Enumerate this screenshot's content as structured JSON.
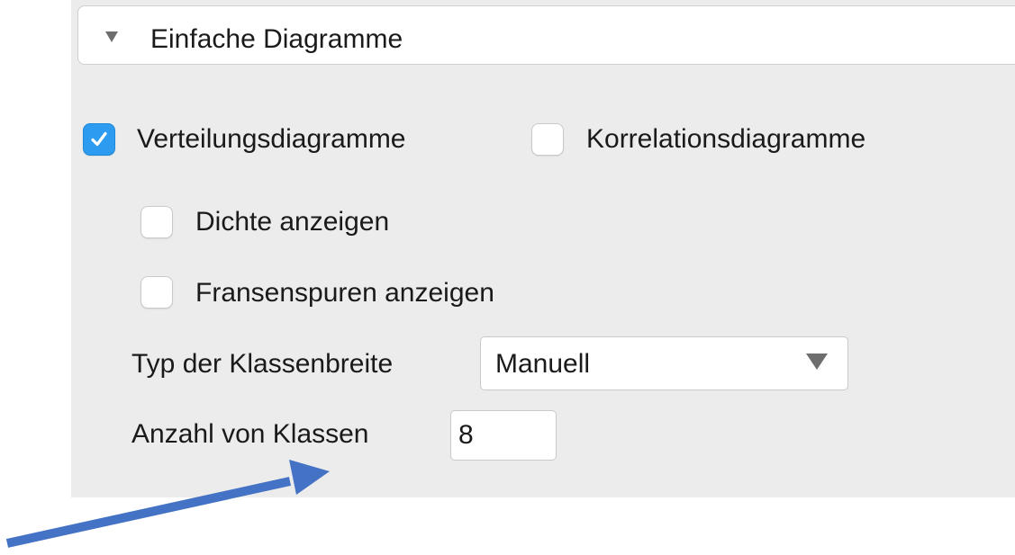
{
  "section": {
    "title": "Einfache Diagramme"
  },
  "options": {
    "verteilung": {
      "label": "Verteilungsdiagramme",
      "checked": true
    },
    "korrelation": {
      "label": "Korrelationsdiagramme",
      "checked": false
    },
    "dichte": {
      "label": "Dichte anzeigen",
      "checked": false
    },
    "fransen": {
      "label": "Fransenspuren anzeigen",
      "checked": false
    }
  },
  "klassenbreite": {
    "label": "Typ der Klassenbreite",
    "selected": "Manuell"
  },
  "klassen": {
    "label": "Anzahl von Klassen",
    "value": "8"
  },
  "colors": {
    "accent": "#2d9cf0",
    "panel": "#ececec",
    "annotation_arrow": "#4472c4"
  },
  "icons": {
    "disclosure": "disclosure-triangle-down-icon",
    "check": "checkmark-icon",
    "select_caret": "chevron-down-icon",
    "annotation": "arrow-icon"
  }
}
